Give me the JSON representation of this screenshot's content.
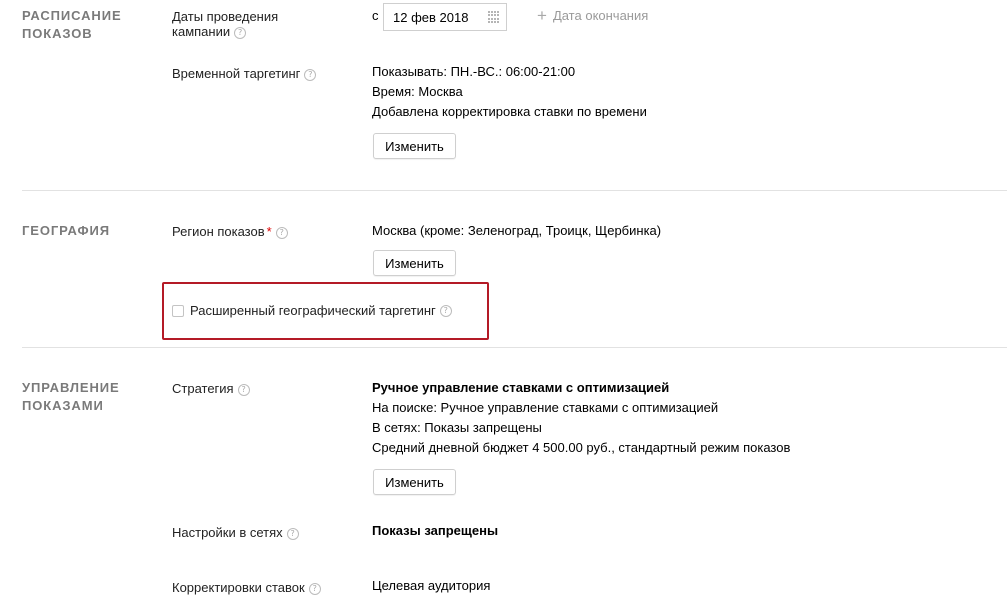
{
  "help_glyph": "?",
  "schedule": {
    "section_title_line1": "Расписание",
    "section_title_line2": "показов",
    "dates_label_line1": "Даты проведения",
    "dates_label_line2": "кампании",
    "from_prefix": "с",
    "start_date": "12 фев 2018",
    "add_end_date_plus": "+",
    "add_end_date": "Дата окончания",
    "time_targeting_label": "Временной таргетинг",
    "time_lines": [
      "Показывать: ПН.-ВС.: 06:00-21:00",
      "Время: Москва",
      "Добавлена корректировка ставки по времени"
    ],
    "change_button": "Изменить"
  },
  "geography": {
    "section_title": "География",
    "region_label": "Регион показов",
    "required_mark": "*",
    "region_value": "Москва (кроме: Зеленоград, Троицк, Щербинка)",
    "change_button": "Изменить",
    "extended_targeting_label": "Расширенный географический таргетинг",
    "extended_targeting_checked": false,
    "highlight_color": "#b41a26"
  },
  "management": {
    "section_title_line1": "Управление",
    "section_title_line2": "показами",
    "strategy_label": "Стратегия",
    "strategy_title": "Ручное управление ставками с оптимизацией",
    "strategy_lines": [
      "На поиске: Ручное управление ставками с оптимизацией",
      "В сетях: Показы запрещены",
      "Средний дневной бюджет 4 500.00 руб., стандартный режим показов"
    ],
    "change_button": "Изменить",
    "networks_label": "Настройки в сетях",
    "networks_value": "Показы запрещены",
    "bid_adjustments_label": "Корректировки ставок",
    "bid_adjustments_value": "Целевая аудитория"
  }
}
